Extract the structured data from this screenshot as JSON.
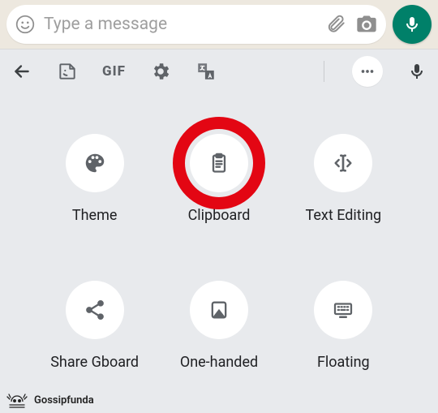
{
  "chat": {
    "placeholder": "Type a message",
    "accent": "#008069"
  },
  "topbar": {
    "gif_label": "GIF"
  },
  "tiles": [
    {
      "id": "theme",
      "label": "Theme"
    },
    {
      "id": "clipboard",
      "label": "Clipboard"
    },
    {
      "id": "text-editing",
      "label": "Text Editing"
    },
    {
      "id": "share-gboard",
      "label": "Share Gboard"
    },
    {
      "id": "one-handed",
      "label": "One-handed"
    },
    {
      "id": "floating",
      "label": "Floating"
    }
  ],
  "watermark": {
    "text": "Gossipfunda"
  }
}
